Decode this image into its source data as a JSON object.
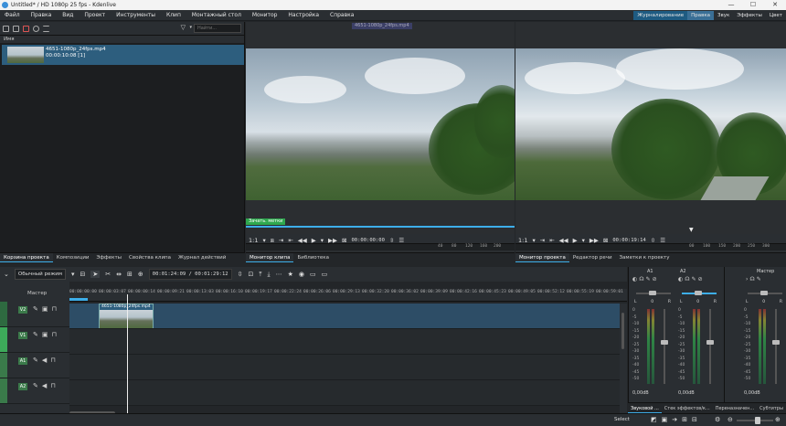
{
  "window": {
    "title": "Untitled* / HD 1080p 25 fps - Kdenlive",
    "controls": [
      "—",
      "☐",
      "✕"
    ]
  },
  "menu": {
    "items": [
      "Файл",
      "Правка",
      "Вид",
      "Проект",
      "Инструменты",
      "Клип",
      "Монтажный стол",
      "Монитор",
      "Настройка",
      "Справка"
    ]
  },
  "layouts": {
    "items": [
      "Журналирование",
      "Правка",
      "Звук",
      "Эффекты",
      "Цвет"
    ],
    "active": "Правка"
  },
  "bin": {
    "search_placeholder": "Найти...",
    "column_name": "Имя",
    "clip": {
      "name": "4651-1080p_24fps.mp4",
      "duration": "00:00:10:08 [1]"
    }
  },
  "project_tabs": {
    "items": [
      "Корзина проекта",
      "Композиции",
      "Эффекты",
      "Свойства клипа",
      "Журнал действий"
    ],
    "active": "Корзина проекта"
  },
  "clip_monitor": {
    "overlay_label": "4651-1080p_24fps.mp4",
    "marker_badge": "Зачать. метки",
    "zoom": "1:1",
    "timecode": "00:00:00:00",
    "ruler_ticks": [
      "40",
      "80",
      "120",
      "160",
      "200",
      "240"
    ],
    "tabs": [
      "Монитор клипа",
      "Библиотека"
    ],
    "active_tab": "Монитор клипа"
  },
  "project_monitor": {
    "zoom": "1:1",
    "timecode": "00:00:19:14",
    "ruler_ticks": [
      "00",
      "100",
      "150",
      "200",
      "250",
      "300",
      "350"
    ],
    "tabs": [
      "Монитор проекта",
      "Редактор речи",
      "Заметки к проекту"
    ],
    "active_tab": "Монитор проекта"
  },
  "timeline_toolbar": {
    "mode": "Обычный режим",
    "position": "00:01:24:09",
    "separator": "/",
    "duration": "00:01:29:12"
  },
  "timeline": {
    "master_label": "Мастер",
    "ruler": [
      "00:00:00:00",
      "00:00:03:07",
      "00:00:00:14",
      "00:00:09:21",
      "00:00:13:03",
      "00:00:16:10",
      "00:00:19:17",
      "00:00:22:24",
      "00:00:26:06",
      "00:00:29:13",
      "00:00:32:20",
      "00:00:36:02",
      "00:00:39:09",
      "00:00:42:16",
      "00:00:45:23",
      "00:00:49:05",
      "00:00:52:12",
      "00:00:55:19",
      "00:00:59:01",
      "00:01:02:08",
      "00:01:05:15",
      "00:01:08:22"
    ],
    "tracks": [
      {
        "label": "V2",
        "color": "#2e6a40"
      },
      {
        "label": "V1",
        "color": "#2e6a40"
      },
      {
        "label": "A1",
        "color": "#3a7a4a"
      },
      {
        "label": "A2",
        "color": "#3a7a4a"
      }
    ],
    "clip_label": "4651-1080p_24fps.mp4"
  },
  "mixer": {
    "channels": [
      {
        "name": "A1",
        "db": "0,00dB"
      },
      {
        "name": "A2",
        "db": "0,00dB"
      },
      {
        "name": "Мастер",
        "db": "0,00dB"
      }
    ],
    "scale": [
      "0",
      "-5",
      "-10",
      "-15",
      "-20",
      "-25",
      "-30",
      "-35",
      "-40",
      "-45",
      "-50"
    ],
    "lr": [
      "L",
      "0",
      "R"
    ]
  },
  "bottom_tabs": {
    "items": [
      "Звуковой ...",
      "Стек эффектов/к...",
      "Переназначен...",
      "Субтитры"
    ],
    "active": "Звуковой ..."
  },
  "status": {
    "select_label": "Select"
  },
  "colors": {
    "accent": "#3daee9",
    "selection": "#2d5e7e",
    "active_layout": "#1e5b82",
    "marker_green": "#2fa84f"
  }
}
